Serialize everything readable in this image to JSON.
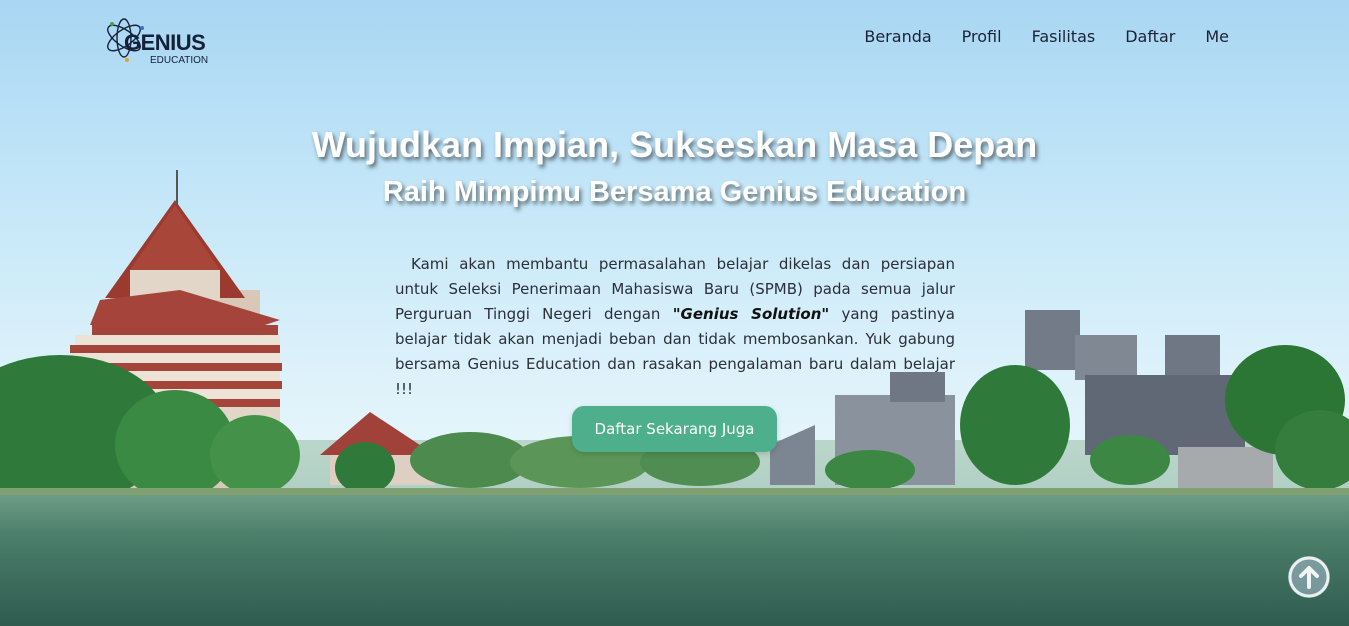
{
  "brand": {
    "name": "GENIUS",
    "tagline": "EDUCATION"
  },
  "nav": {
    "items": [
      {
        "label": "Beranda"
      },
      {
        "label": "Profil"
      },
      {
        "label": "Fasilitas"
      },
      {
        "label": "Daftar"
      },
      {
        "label": "Me"
      }
    ]
  },
  "hero": {
    "headline": "Wujudkan Impian, Sukseskan Masa Depan",
    "subheadline": "Raih Mimpimu Bersama Genius Education",
    "description_before": "Kami akan membantu permasalahan belajar dikelas dan persiapan untuk Seleksi Penerimaan Mahasiswa Baru (SPMB) pada semua jalur Perguruan Tinggi Negeri dengan ",
    "description_emphasis": "\"Genius Solution\"",
    "description_after": " yang pastinya belajar tidak akan menjadi beban dan tidak membosankan. Yuk gabung bersama Genius Education dan rasakan pengalaman baru dalam belajar !!!",
    "cta_label": "Daftar Sekarang Juga"
  },
  "icons": {
    "logo": "atom-logo-icon",
    "back_to_top": "arrow-up-circle-icon"
  },
  "colors": {
    "accent": "#4daf8c",
    "nav_text": "#1d2233",
    "headline": "#ffffff"
  }
}
